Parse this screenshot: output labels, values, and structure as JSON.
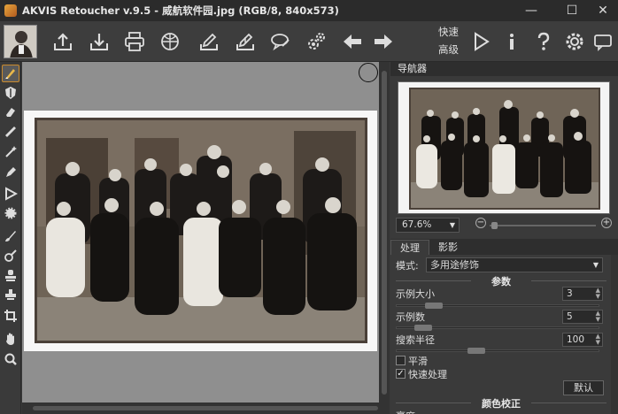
{
  "window": {
    "title": "AKVIS Retoucher v.9.5 - 威航软件园.jpg (RGB/8, 840x573)",
    "min": "—",
    "max": "☐",
    "close": "✕"
  },
  "toolbar": {
    "quick_label": "快速",
    "advanced_label": "高级",
    "icons": [
      "open-image-icon",
      "save-image-icon",
      "print-icon",
      "share-icon",
      "import-preset-icon",
      "export-preset-icon",
      "comment-icon",
      "settings-gears-icon",
      "undo-arrow-icon",
      "redo-arrow-icon",
      "run-icon",
      "info-icon",
      "help-icon",
      "preferences-icon",
      "chat-icon"
    ]
  },
  "navigator": {
    "title": "导航器",
    "zoom": "67.6%",
    "zoom_minus": "−",
    "zoom_plus": "+"
  },
  "tabs": {
    "process": "处理",
    "shadow": "影影"
  },
  "settings": {
    "mode_label": "模式:",
    "mode_value": "多用途修饰",
    "params_heading": "参数",
    "sample_size_label": "示例大小",
    "sample_size_value": "3",
    "sample_count_label": "示例数",
    "sample_count_value": "5",
    "search_radius_label": "搜索半径",
    "search_radius_value": "100",
    "smooth_label": "平滑",
    "smooth_checked": false,
    "fast_label": "快速处理",
    "fast_checked": true,
    "default_button": "默认",
    "color_heading": "颜色校正",
    "brightness_label": "亮度"
  },
  "colors": {
    "accent": "#c98a2d",
    "background": "#3a3a3a"
  }
}
